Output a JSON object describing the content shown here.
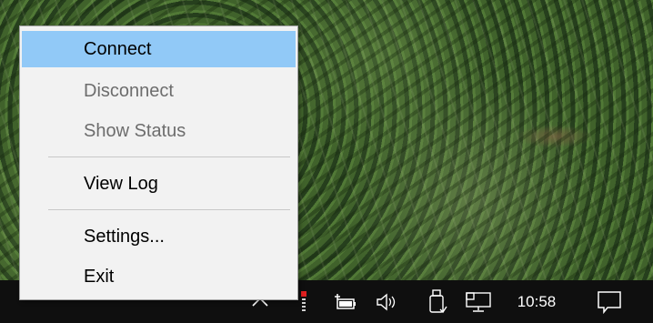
{
  "context_menu": {
    "items": [
      {
        "label": "Connect",
        "state": "highlighted"
      },
      {
        "label": "Disconnect",
        "state": "disabled"
      },
      {
        "label": "Show Status",
        "state": "disabled"
      },
      {
        "label": "View Log",
        "state": "enabled"
      },
      {
        "label": "Settings...",
        "state": "enabled"
      },
      {
        "label": "Exit",
        "state": "enabled"
      }
    ]
  },
  "taskbar": {
    "tray_icons": [
      "chevron-up-icon",
      "app-tray-icon",
      "battery-icon",
      "volume-icon",
      "usb-drive-icon",
      "network-icon"
    ],
    "clock": "10:58",
    "notification_icon": "action-center-icon"
  },
  "colors": {
    "menu_background": "#f2f2f2",
    "menu_highlight": "#91c9f7",
    "disabled_text": "#6d6d6d",
    "taskbar": "#0f0f0f"
  }
}
